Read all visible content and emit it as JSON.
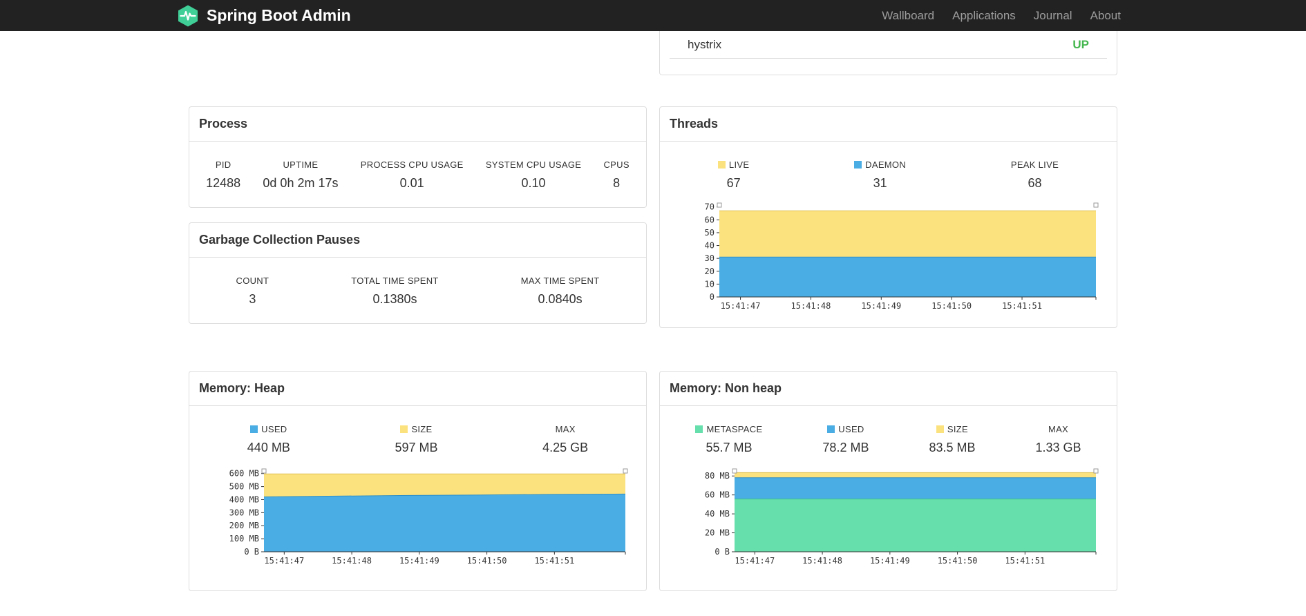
{
  "navbar": {
    "brand": "Spring Boot Admin",
    "items": [
      {
        "label": "Wallboard"
      },
      {
        "label": "Applications"
      },
      {
        "label": "Journal"
      },
      {
        "label": "About"
      }
    ]
  },
  "colors": {
    "up_green": "#43b64d",
    "area_yellow": "#fce27f",
    "area_blue": "#4aade3",
    "area_green": "#67dfad",
    "logo_green": "#3fcf97"
  },
  "application": {
    "name": "hystrix",
    "status": "UP"
  },
  "panels": {
    "process": {
      "title": "Process",
      "stats": [
        {
          "label": "PID",
          "value": "12488"
        },
        {
          "label": "UPTIME",
          "value": "0d 0h 2m 17s"
        },
        {
          "label": "PROCESS CPU USAGE",
          "value": "0.01"
        },
        {
          "label": "SYSTEM CPU USAGE",
          "value": "0.10"
        },
        {
          "label": "CPUS",
          "value": "8"
        }
      ]
    },
    "gc": {
      "title": "Garbage Collection Pauses",
      "stats": [
        {
          "label": "COUNT",
          "value": "3"
        },
        {
          "label": "TOTAL TIME SPENT",
          "value": "0.1380s"
        },
        {
          "label": "MAX TIME SPENT",
          "value": "0.0840s"
        }
      ]
    },
    "threads": {
      "title": "Threads",
      "legend": [
        {
          "label": "LIVE",
          "value": "67",
          "color": "#fce27f"
        },
        {
          "label": "DAEMON",
          "value": "31",
          "color": "#4aade3"
        },
        {
          "label": "PEAK LIVE",
          "value": "68",
          "color": ""
        }
      ]
    },
    "heap": {
      "title": "Memory: Heap",
      "legend": [
        {
          "label": "USED",
          "value": "440 MB",
          "color": "#4aade3"
        },
        {
          "label": "SIZE",
          "value": "597 MB",
          "color": "#fce27f"
        },
        {
          "label": "MAX",
          "value": "4.25 GB",
          "color": ""
        }
      ]
    },
    "nonheap": {
      "title": "Memory: Non heap",
      "legend": [
        {
          "label": "METASPACE",
          "value": "55.7 MB",
          "color": "#67dfad"
        },
        {
          "label": "USED",
          "value": "78.2 MB",
          "color": "#4aade3"
        },
        {
          "label": "SIZE",
          "value": "83.5 MB",
          "color": "#fce27f"
        },
        {
          "label": "MAX",
          "value": "1.33 GB",
          "color": ""
        }
      ]
    }
  },
  "chart_data": [
    {
      "id": "threads",
      "type": "area",
      "title": "Threads",
      "x_labels": [
        "15:41:47",
        "15:41:48",
        "15:41:49",
        "15:41:50",
        "15:41:51"
      ],
      "y_ticks": [
        {
          "v": 0,
          "label": "0"
        },
        {
          "v": 10,
          "label": "10"
        },
        {
          "v": 20,
          "label": "20"
        },
        {
          "v": 30,
          "label": "30"
        },
        {
          "v": 40,
          "label": "40"
        },
        {
          "v": 50,
          "label": "50"
        },
        {
          "v": 60,
          "label": "60"
        },
        {
          "v": 70,
          "label": "70"
        }
      ],
      "ymax": 72,
      "series": [
        {
          "name": "live",
          "color": "#fce27f",
          "stroke": "#dec050",
          "values": [
            67,
            67,
            67,
            67,
            67,
            67
          ]
        },
        {
          "name": "daemon",
          "color": "#4aade3",
          "stroke": "#2e8fc6",
          "values": [
            31,
            31,
            31,
            31,
            31,
            31
          ]
        }
      ]
    },
    {
      "id": "heap",
      "type": "area",
      "title": "Memory: Heap",
      "x_labels": [
        "15:41:47",
        "15:41:48",
        "15:41:49",
        "15:41:50",
        "15:41:51"
      ],
      "y_ticks": [
        {
          "v": 0,
          "label": "0 B"
        },
        {
          "v": 100,
          "label": "100 MB"
        },
        {
          "v": 200,
          "label": "200 MB"
        },
        {
          "v": 300,
          "label": "300 MB"
        },
        {
          "v": 400,
          "label": "400 MB"
        },
        {
          "v": 500,
          "label": "500 MB"
        },
        {
          "v": 600,
          "label": "600 MB"
        }
      ],
      "ymax": 625,
      "series": [
        {
          "name": "size",
          "color": "#fce27f",
          "stroke": "#dec050",
          "values": [
            597,
            597,
            597,
            597,
            597,
            597
          ]
        },
        {
          "name": "used",
          "color": "#4aade3",
          "stroke": "#2e8fc6",
          "values": [
            421,
            427,
            432,
            436,
            440,
            443
          ]
        }
      ]
    },
    {
      "id": "nonheap",
      "type": "area",
      "title": "Memory: Non heap",
      "x_labels": [
        "15:41:47",
        "15:41:48",
        "15:41:49",
        "15:41:50",
        "15:41:51"
      ],
      "y_ticks": [
        {
          "v": 0,
          "label": "0 B"
        },
        {
          "v": 20,
          "label": "20 MB"
        },
        {
          "v": 40,
          "label": "40 MB"
        },
        {
          "v": 60,
          "label": "60 MB"
        },
        {
          "v": 80,
          "label": "80 MB"
        }
      ],
      "ymax": 86,
      "series": [
        {
          "name": "size",
          "color": "#fce27f",
          "stroke": "#dec050",
          "values": [
            83.5,
            83.5,
            83.5,
            83.5,
            83.5,
            83.5
          ]
        },
        {
          "name": "used",
          "color": "#4aade3",
          "stroke": "#2e8fc6",
          "values": [
            78.2,
            78.2,
            78.2,
            78.2,
            78.2,
            78.2
          ]
        },
        {
          "name": "metaspace",
          "color": "#67dfad",
          "stroke": "#3cc18d",
          "values": [
            55.7,
            55.7,
            55.7,
            55.7,
            55.7,
            55.7
          ]
        }
      ]
    }
  ]
}
